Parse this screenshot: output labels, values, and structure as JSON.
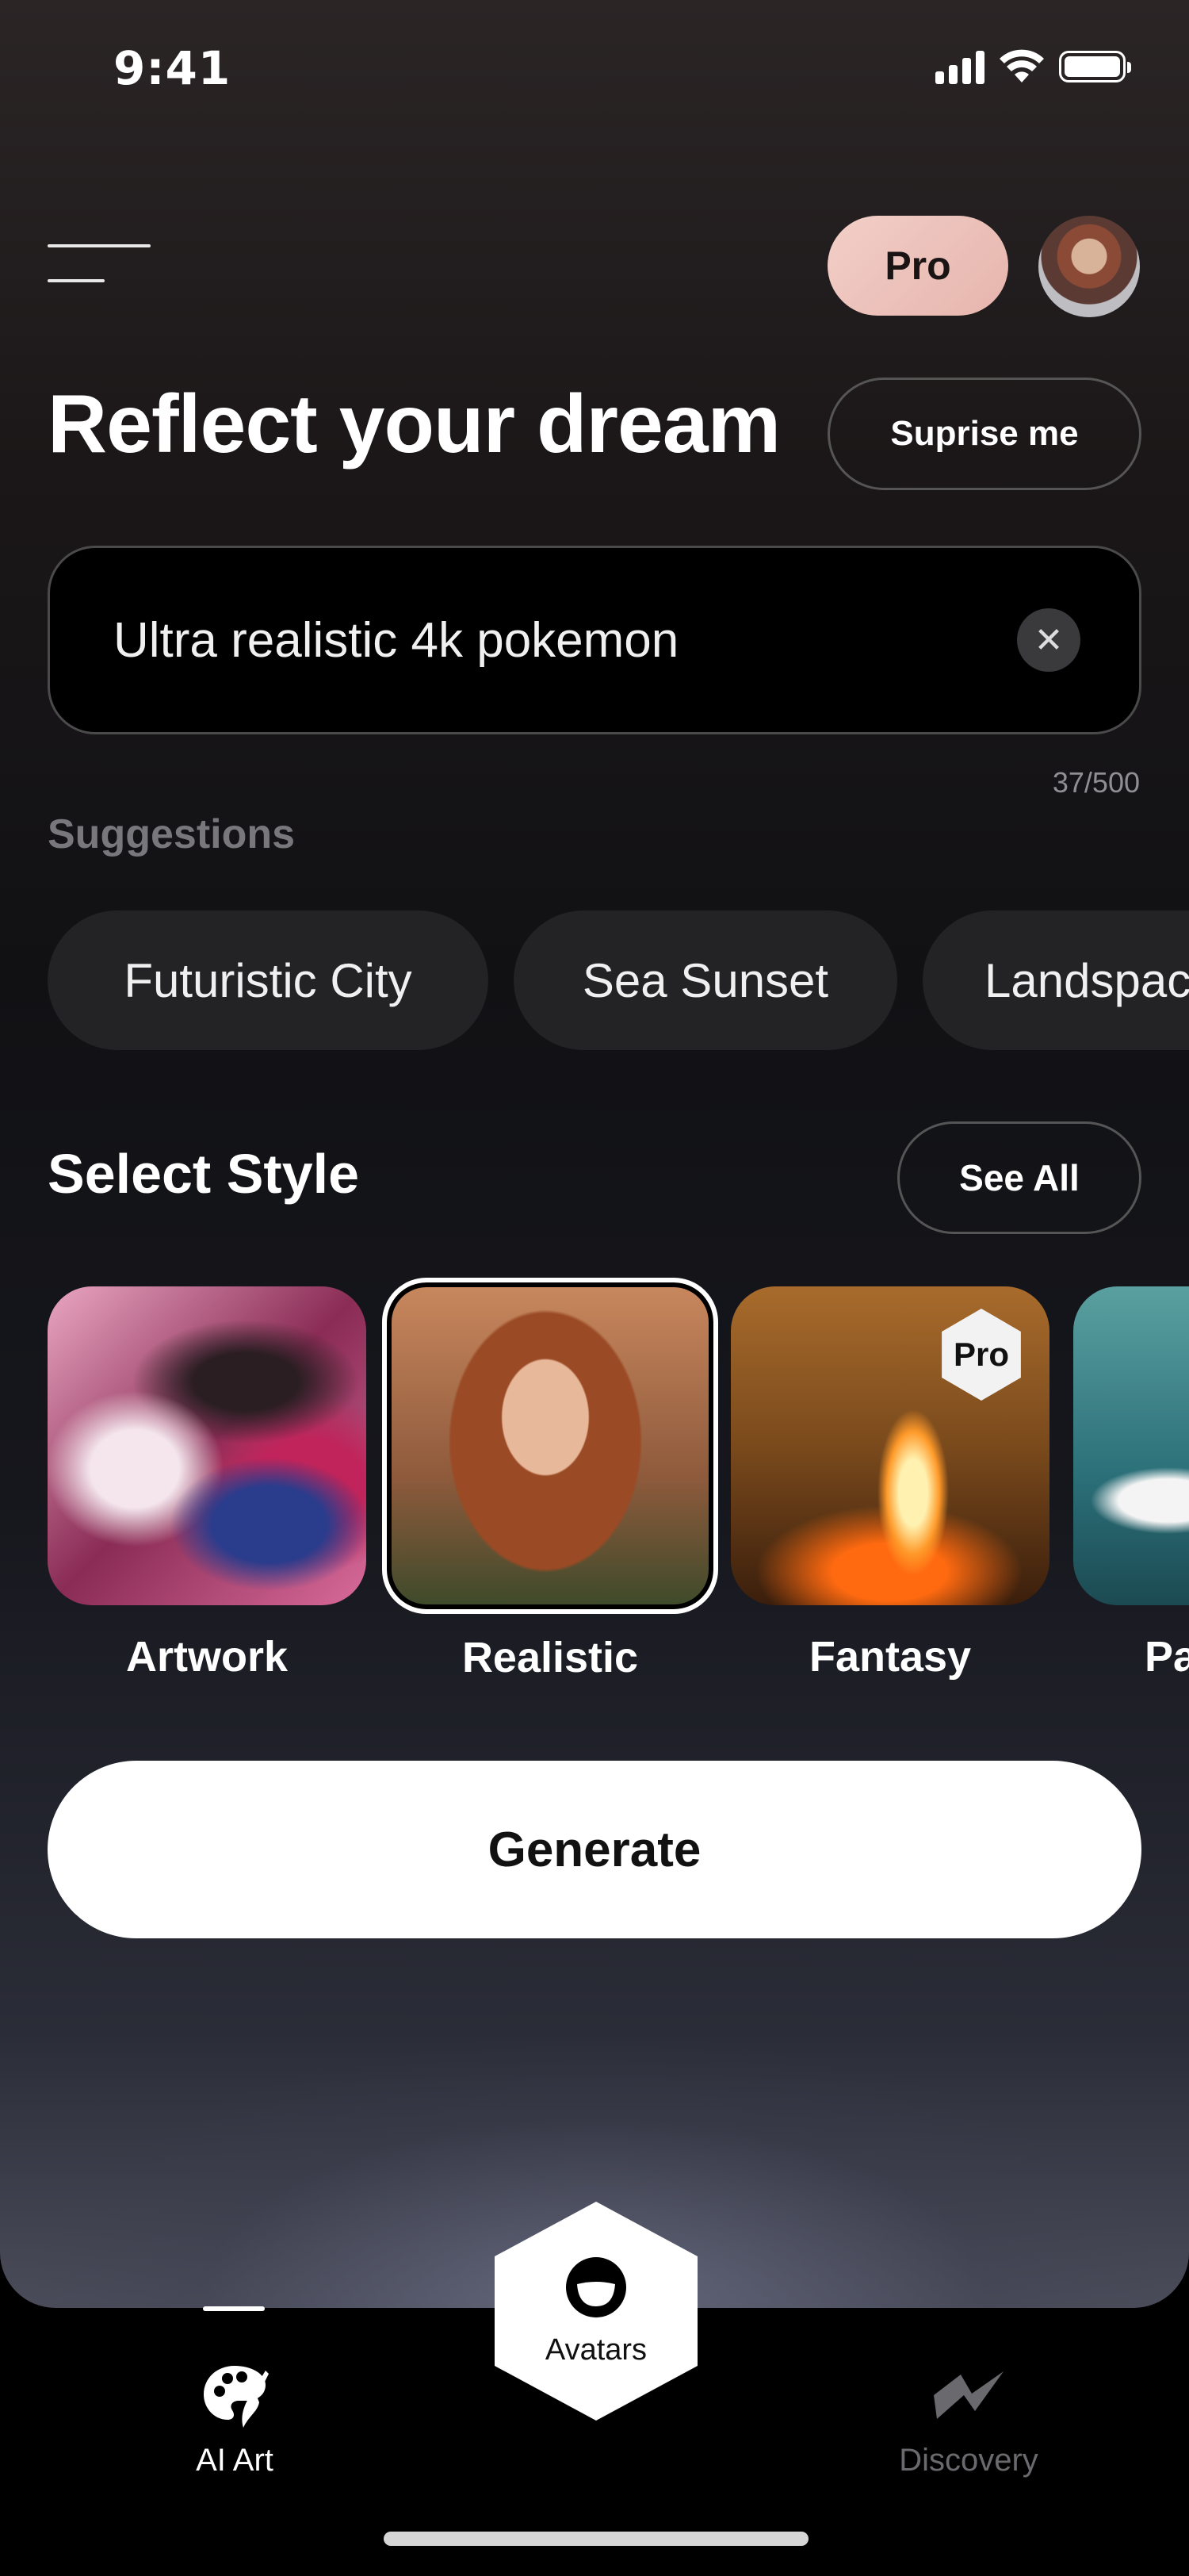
{
  "status_bar": {
    "time": "9:41"
  },
  "header": {
    "pro_label": "Pro",
    "title": "Reflect your dream",
    "surprise_label": "Suprise me"
  },
  "prompt": {
    "value": "Ultra realistic 4k pokemon",
    "char_count": "37/500"
  },
  "suggestions": {
    "label": "Suggestions",
    "items": [
      "Futuristic City",
      "Sea Sunset",
      "Landspac"
    ]
  },
  "styles": {
    "title": "Select Style",
    "see_all_label": "See All",
    "selected": "Realistic",
    "items": [
      {
        "label": "Artwork",
        "pro": false
      },
      {
        "label": "Realistic",
        "pro": false
      },
      {
        "label": "Fantasy",
        "pro": true,
        "badge": "Pro"
      },
      {
        "label": "Pa",
        "pro": false
      }
    ]
  },
  "generate_label": "Generate",
  "bottom_nav": {
    "items": [
      {
        "label": "AI Art",
        "icon": "palette-icon",
        "active": true
      },
      {
        "label": "Avatars",
        "icon": "avatar-face-icon",
        "active": false
      },
      {
        "label": "Discovery",
        "icon": "lightning-icon",
        "active": false
      }
    ]
  },
  "colors": {
    "pro_pill": "#ecc2ba",
    "chip_bg": "#232325",
    "accent_white": "#ffffff"
  }
}
